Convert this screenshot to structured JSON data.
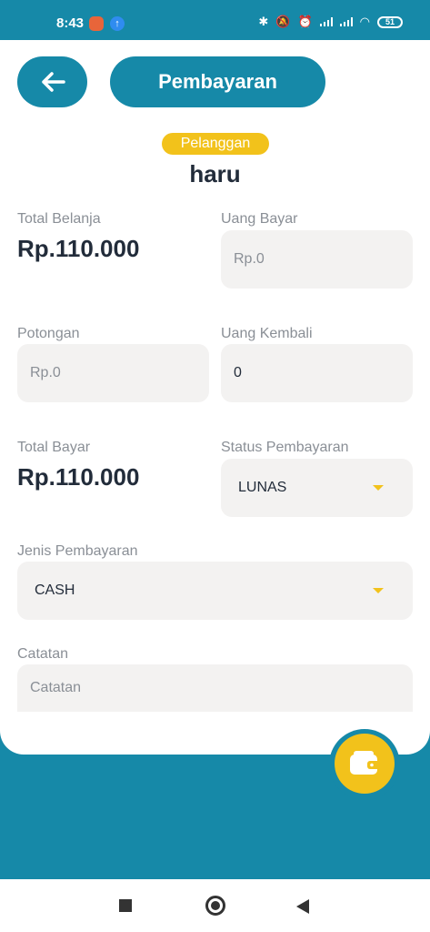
{
  "status_bar": {
    "time": "8:43",
    "battery": "51",
    "app_icon_2": "↑"
  },
  "header": {
    "back_icon": "arrow-left-icon",
    "title": "Pembayaran"
  },
  "customer": {
    "badge": "Pelanggan",
    "name": "haru"
  },
  "form": {
    "total_belanja_label": "Total Belanja",
    "total_belanja_value": "Rp.110.000",
    "uang_bayar_label": "Uang Bayar",
    "uang_bayar_placeholder": "Rp.0",
    "potongan_label": "Potongan",
    "potongan_placeholder": "Rp.0",
    "uang_kembali_label": "Uang Kembali",
    "uang_kembali_value": "0",
    "total_bayar_label": "Total Bayar",
    "total_bayar_value": "Rp.110.000",
    "status_label": "Status Pembayaran",
    "status_value": "LUNAS",
    "jenis_label": "Jenis Pembayaran",
    "jenis_value": "CASH",
    "catatan_label": "Catatan",
    "catatan_placeholder": "Catatan"
  },
  "fab": {
    "icon": "wallet-icon"
  },
  "colors": {
    "primary": "#1689a8",
    "accent": "#f2c21b",
    "field_bg": "#f3f2f1",
    "text_dark": "#222c3a",
    "text_muted": "#8a8f96"
  }
}
